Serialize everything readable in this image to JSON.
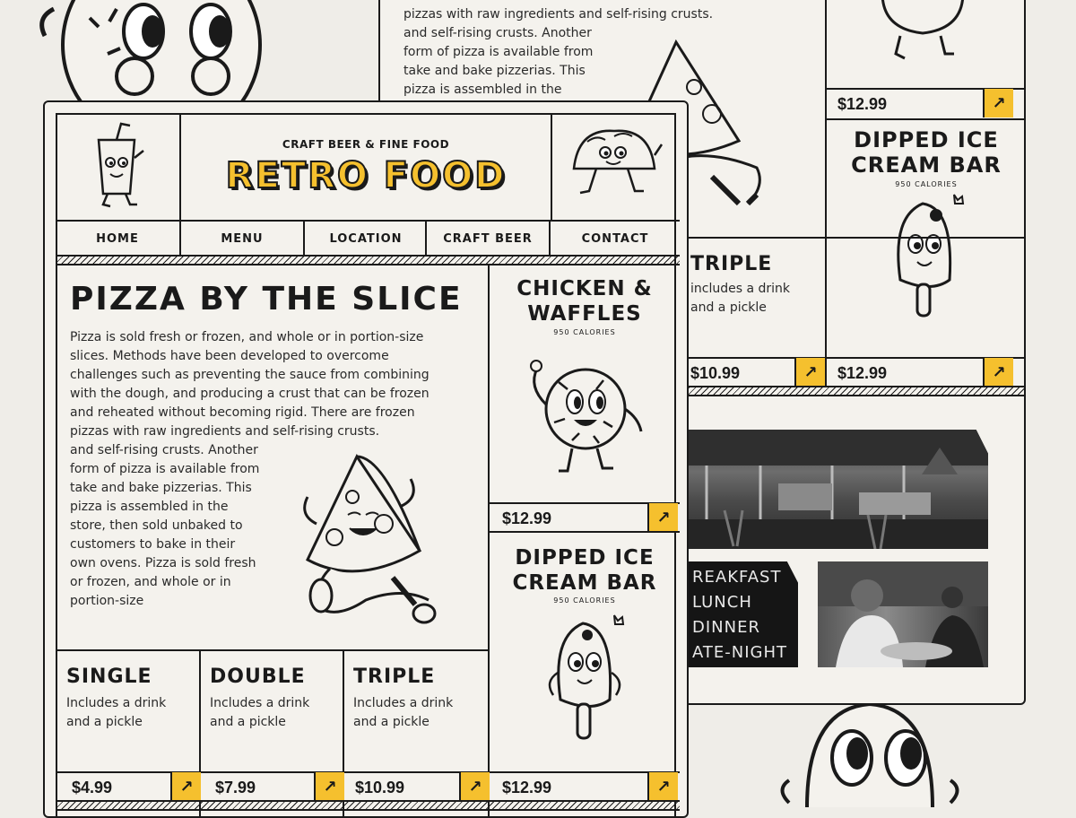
{
  "brand": {
    "tagline": "CRAFT BEER & FINE FOOD",
    "name": "RETRO FOOD",
    "accent": "#f5c02e",
    "ink": "#1a1a1a",
    "paper": "#f4f2ed"
  },
  "nav": {
    "items": [
      {
        "label": "HOME"
      },
      {
        "label": "MENU"
      },
      {
        "label": "LOCATION"
      },
      {
        "label": "CRAFT BEER"
      },
      {
        "label": "CONTACT"
      }
    ]
  },
  "hero": {
    "title": "PIZZA BY THE SLICE",
    "paragraph_lines": [
      "Pizza is sold fresh or frozen, and whole or in portion-size",
      "slices. Methods have been developed to overcome",
      "challenges such as preventing the sauce from combining",
      "with the dough, and producing a crust that can be frozen",
      "and reheated without becoming rigid. There are frozen",
      "pizzas with raw ingredients and self-rising crusts."
    ],
    "narrow_lines": [
      "and self-rising crusts. Another",
      "form of pizza is available from",
      "take and bake pizzerias. This",
      "pizza is assembled in the",
      "store, then sold unbaked to",
      "customers to bake in their",
      "own ovens. Pizza is sold fresh",
      "or frozen, and whole or in",
      "portion-size"
    ]
  },
  "combos": [
    {
      "name": "SINGLE",
      "desc1": "Includes a drink",
      "desc2": "and a pickle",
      "price": "$4.99"
    },
    {
      "name": "DOUBLE",
      "desc1": "Includes a drink",
      "desc2": "and a pickle",
      "price": "$7.99"
    },
    {
      "name": "TRIPLE",
      "desc1": "Includes a drink",
      "desc2": "and a pickle",
      "price": "$10.99"
    }
  ],
  "side_items": [
    {
      "name_line1": "CHICKEN &",
      "name_line2": "WAFFLES",
      "calories": "950 CALORIES",
      "price": "$12.99"
    },
    {
      "name_line1": "DIPPED ICE",
      "name_line2": "CREAM BAR",
      "calories": "950 CALORIES",
      "price": "$12.99"
    }
  ],
  "back_card": {
    "text_lines": [
      "pizzas with raw ingredients and self-rising crusts.",
      "and self-rising crusts. Another",
      "form of pizza is available from",
      "take and bake pizzerias. This",
      "pizza is assembled in the"
    ],
    "top_price": "$12.99",
    "item": {
      "name_line1": "DIPPED ICE",
      "name_line2": "CREAM BAR",
      "calories": "950 CALORIES",
      "price": "$12.99"
    },
    "triple": {
      "name": "TRIPLE",
      "desc1": "includes a drink",
      "desc2": "and a pickle",
      "price": "$10.99"
    },
    "chalkboard": [
      "REAKFAST",
      "LUNCH",
      "DINNER",
      "ATE-NIGHT"
    ]
  },
  "icons": {
    "arrow": "↗"
  }
}
